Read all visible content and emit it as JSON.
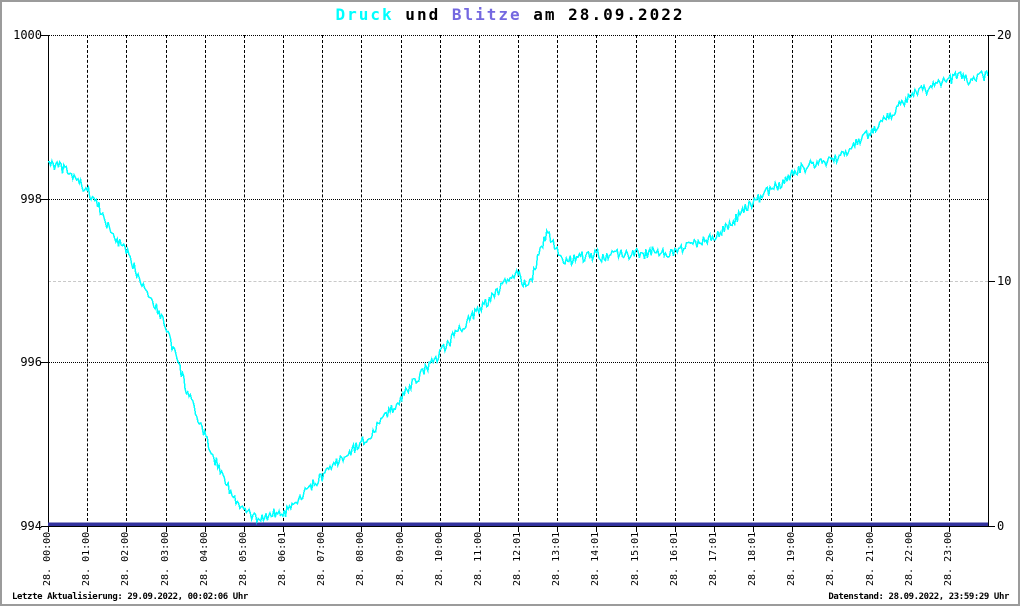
{
  "window": {
    "border_color": "#9b9b9b",
    "background": "#ffffff"
  },
  "title": {
    "segments": [
      {
        "text": "Druck",
        "color": "#00ffff"
      },
      {
        "text": " und ",
        "color": "#000000"
      },
      {
        "text": "Blitze",
        "color": "#7468e0"
      },
      {
        "text": " am 28.09.2022",
        "color": "#000000"
      }
    ]
  },
  "axes": {
    "left": {
      "labels": [
        "1000",
        "998",
        "996",
        "994"
      ],
      "values": [
        1000,
        998,
        996,
        994
      ],
      "min": 994,
      "max": 1000
    },
    "right": {
      "labels": [
        "20",
        "10",
        "0"
      ],
      "values": [
        20,
        10,
        0
      ],
      "min": 0,
      "max": 20
    },
    "x": {
      "labels": [
        "28. 00:00",
        "28. 01:00",
        "28. 02:00",
        "28. 03:00",
        "28. 04:00",
        "28. 05:00",
        "28. 06:01",
        "28. 07:00",
        "28. 08:00",
        "28. 09:00",
        "28. 10:00",
        "28. 11:00",
        "28. 12:01",
        "28. 13:01",
        "28. 14:01",
        "28. 15:01",
        "28. 16:01",
        "28. 17:01",
        "28. 18:01",
        "28. 19:00",
        "28. 20:00",
        "28. 21:00",
        "28. 22:00",
        "28. 23:00"
      ],
      "hours": [
        0,
        1,
        2,
        3,
        4,
        5,
        6,
        7,
        8,
        9,
        10,
        11,
        12,
        13,
        14,
        15,
        16,
        17,
        18,
        19,
        20,
        21,
        22,
        23
      ]
    }
  },
  "gridlines": {
    "horizontal_black_dotted_left_values": [
      1000,
      998,
      996
    ],
    "horizontal_gray_dashed_right_values": [
      10
    ],
    "vertical_dashed_every_hour": true,
    "black_color": "#000000",
    "gray_color": "#c9c9c9"
  },
  "status_bar": {
    "left": "Letzte Aktualisierung: 29.09.2022, 00:02:06 Uhr",
    "right": "Datenstand: 28.09.2022, 23:59:29 Uhr"
  },
  "chart_data": {
    "type": "line",
    "title": "Druck und Blitze am 28.09.2022",
    "x_axis": "time of day 28.09.2022, hourly ticks 00:00-23:00",
    "ylim_left": [
      994,
      1000
    ],
    "ylim_right": [
      0,
      20
    ],
    "grid": "vertical dashed per hour; dotted horizontal at 998 and 996; light gray at 997 (= right 10); legend none",
    "series": [
      {
        "name": "Druck",
        "axis": "left",
        "color": "#00ffff",
        "x_start_hour": 0,
        "x_step_hours": 0.25,
        "values": [
          998.45,
          998.4,
          998.33,
          998.22,
          998.1,
          997.95,
          997.68,
          997.5,
          997.35,
          997.12,
          996.9,
          996.68,
          996.45,
          996.1,
          995.72,
          995.4,
          995.1,
          994.82,
          994.6,
          994.32,
          994.2,
          994.1,
          994.1,
          994.15,
          994.15,
          994.22,
          994.37,
          994.5,
          994.6,
          994.72,
          994.82,
          994.92,
          995.02,
          995.12,
          995.27,
          995.42,
          995.55,
          995.7,
          995.85,
          995.98,
          996.1,
          996.25,
          996.4,
          996.53,
          996.65,
          996.75,
          996.88,
          997.0,
          997.1,
          996.88,
          997.25,
          997.6,
          997.38,
          997.22,
          997.3,
          997.28,
          997.32,
          997.27,
          997.35,
          997.3,
          997.35,
          997.32,
          997.4,
          997.32,
          997.35,
          997.4,
          997.45,
          997.5,
          997.55,
          997.62,
          997.72,
          997.85,
          997.95,
          998.05,
          998.12,
          998.2,
          998.3,
          998.37,
          998.42,
          998.44,
          998.47,
          998.52,
          998.62,
          998.72,
          998.82,
          998.92,
          999.02,
          999.15,
          999.25,
          999.3,
          999.35,
          999.4,
          999.45,
          999.5,
          999.45,
          999.5,
          999.5
        ]
      },
      {
        "name": "Blitze",
        "axis": "right",
        "color": "#32329d",
        "x_start_hour": 0,
        "x_step_hours": 24,
        "values": [
          0,
          0
        ]
      }
    ]
  }
}
